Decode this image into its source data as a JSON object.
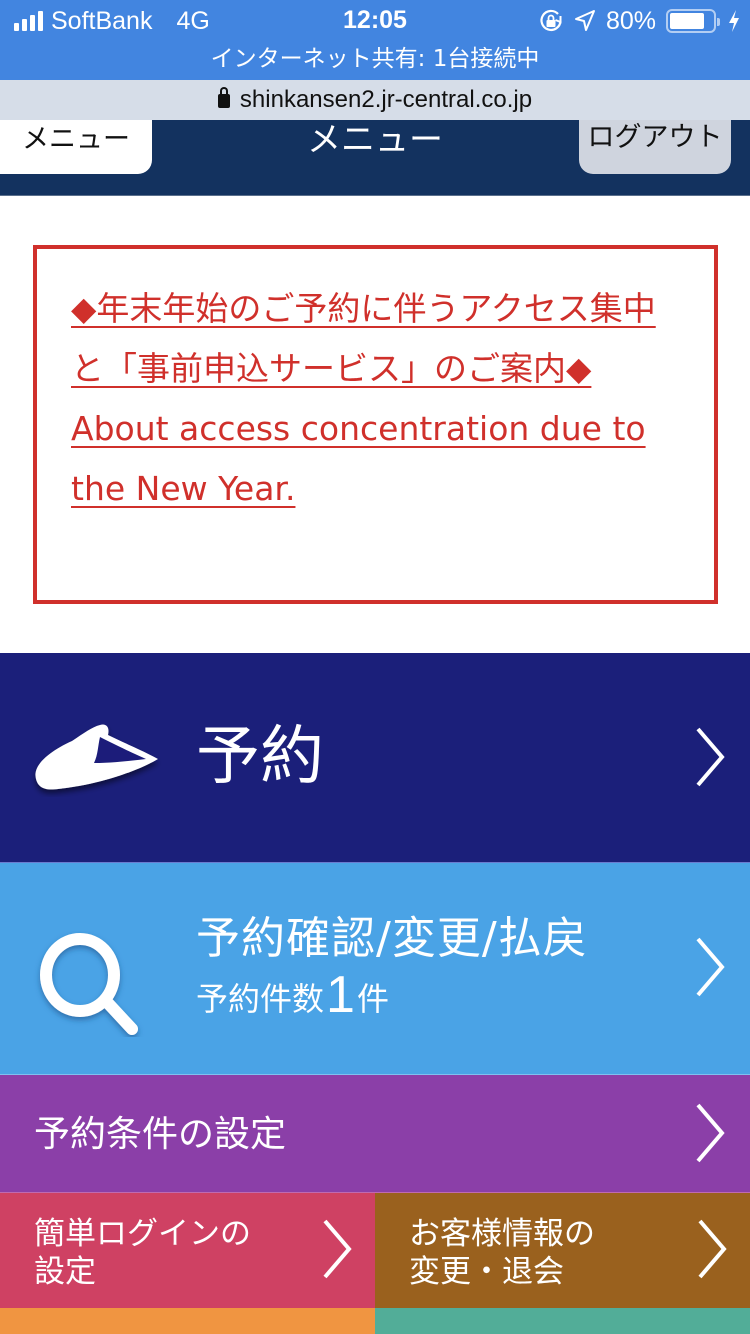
{
  "status_bar": {
    "carrier": "SoftBank",
    "network": "4G",
    "time": "12:05",
    "battery_percent": "80%",
    "battery_level": 0.8,
    "icons": [
      "signal-icon",
      "orientation-lock-icon",
      "location-icon",
      "battery-icon",
      "charging-icon"
    ]
  },
  "hotspot_banner": "インターネット共有: 1台接続中",
  "browser": {
    "url": "shinkansen2.jr-central.co.jp"
  },
  "header": {
    "menu_button": "メニュー",
    "title": "メニュー",
    "logout_button": "ログアウト"
  },
  "notice": {
    "link_text": "◆年末年始のご予約に伴うアクセス集中と「事前申込サービス」のご案内◆ About access concentration due to the New Year.",
    "color": "#d0302b"
  },
  "menu": {
    "reserve": {
      "label": "予約",
      "icon": "shinkansen-train-icon",
      "color": "#1b1f7a"
    },
    "confirm": {
      "title": "予約確認/変更/払戻",
      "count_prefix": "予約件数",
      "count": "1",
      "count_suffix": "件",
      "icon": "search-icon",
      "color": "#4aa3e6"
    },
    "conditions": {
      "label": "予約条件の設定",
      "color": "#8b3fa8"
    },
    "easy_login": {
      "line1": "簡単ログインの",
      "line2": "設定",
      "color": "#cf4163"
    },
    "customer_info": {
      "line1": "お客様情報の",
      "line2": "変更・退会",
      "color": "#9a611e"
    },
    "partial_tiles": [
      {
        "color": "#f09541"
      },
      {
        "color": "#52ad98"
      }
    ]
  }
}
